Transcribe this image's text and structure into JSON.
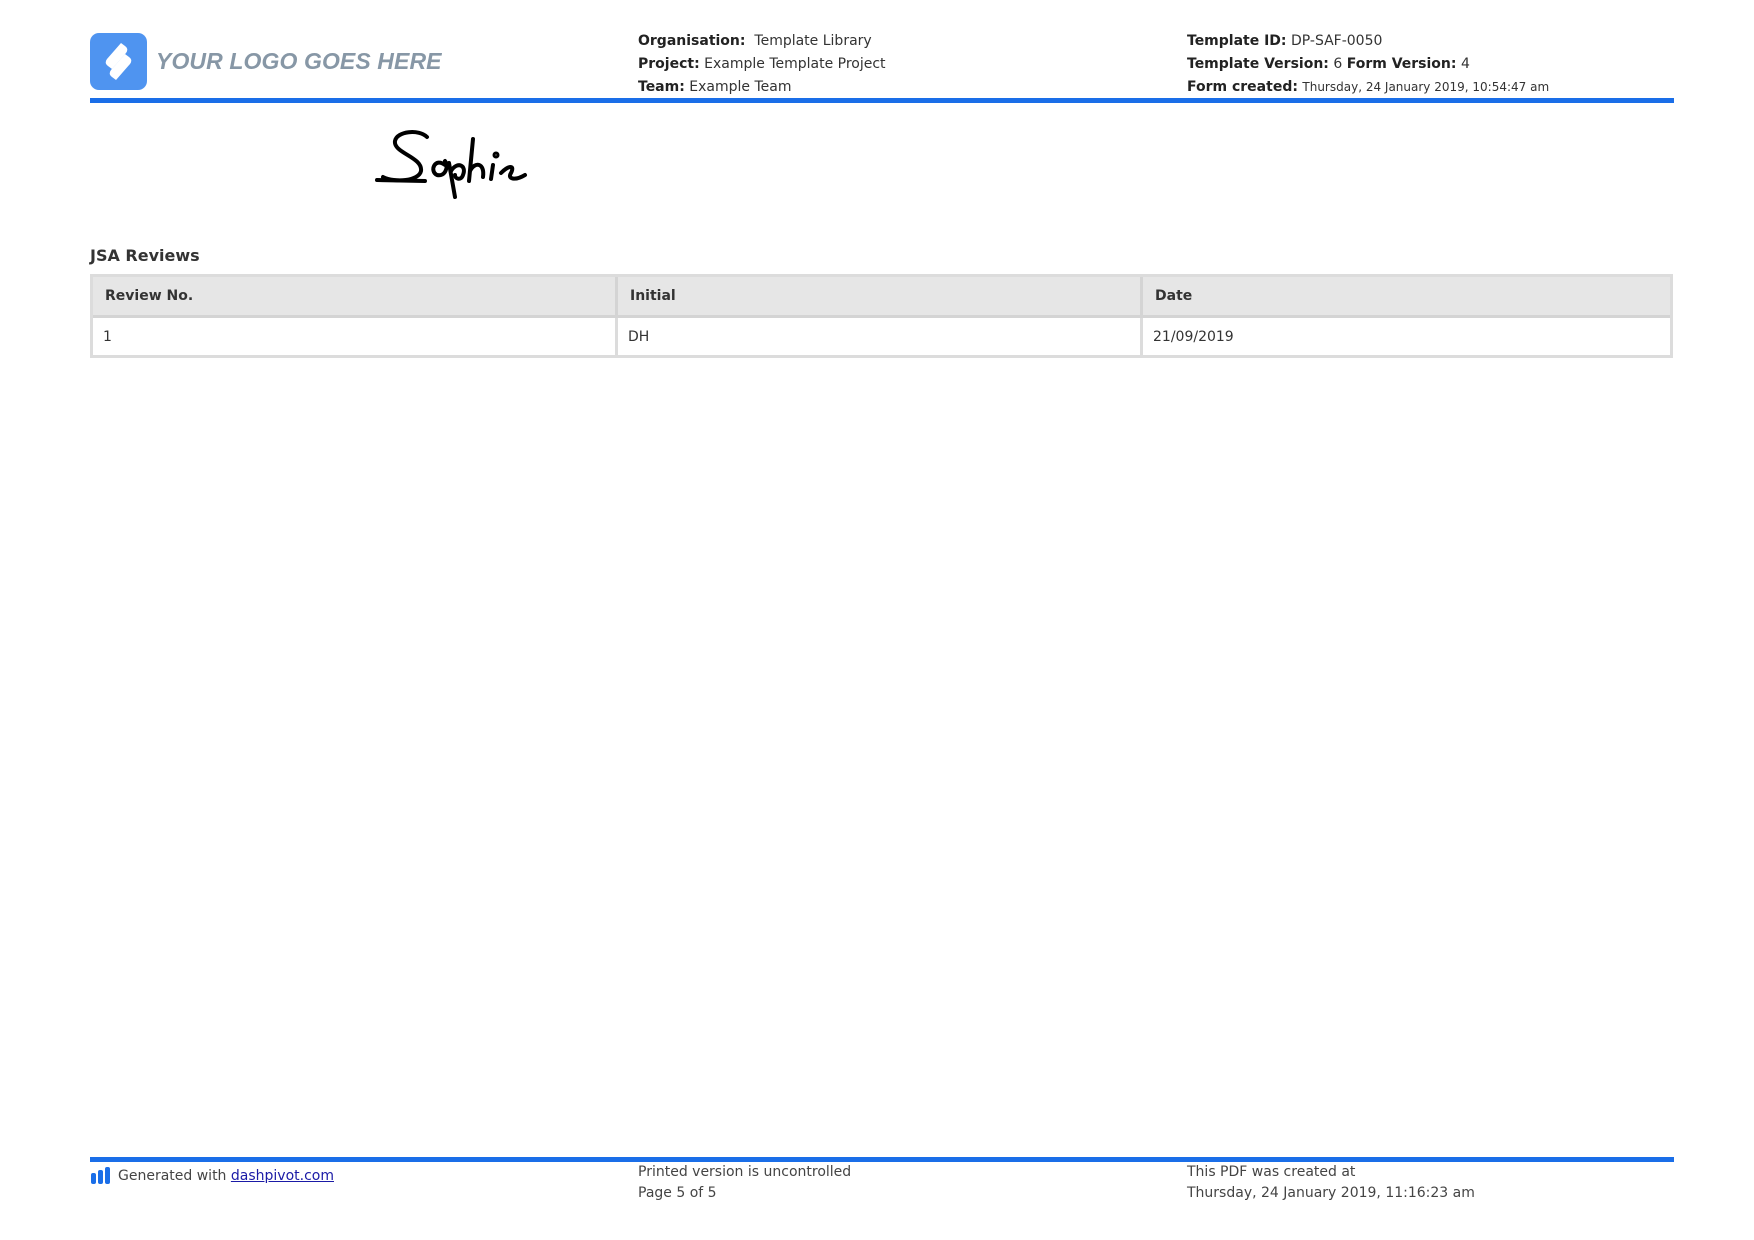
{
  "header": {
    "logo_text": "YOUR LOGO GOES HERE",
    "organisation_label": "Organisation:",
    "organisation_value": "Template Library",
    "project_label": "Project:",
    "project_value": "Example Template Project",
    "team_label": "Team:",
    "team_value": "Example Team",
    "template_id_label": "Template ID:",
    "template_id_value": "DP-SAF-0050",
    "template_version_label": "Template Version:",
    "template_version_value": "6",
    "form_version_label": "Form Version:",
    "form_version_value": "4",
    "form_created_label": "Form created:",
    "form_created_value": "Thursday, 24 January 2019, 10:54:47 am"
  },
  "signature": {
    "name": "Sophie"
  },
  "jsa_reviews": {
    "title": "JSA Reviews",
    "columns": [
      "Review No.",
      "Initial",
      "Date"
    ],
    "rows": [
      [
        "1",
        "DH",
        "21/09/2019"
      ]
    ]
  },
  "footer": {
    "generated_prefix": "Generated with",
    "generated_link": "dashpivot.com",
    "uncontrolled": "Printed version is uncontrolled",
    "page": "Page 5 of 5",
    "created_line1": "This PDF was created at",
    "created_line2": "Thursday, 24 January 2019, 11:16:23 am"
  },
  "colors": {
    "accent": "#1a6ee8",
    "logo_bg": "#4f94f0",
    "logo_text": "#8797a6",
    "table_header_bg": "#e6e6e6",
    "link": "#1a1aa6"
  },
  "icons": {
    "logo": "logo-icon",
    "footer": "dashpivot-bars-icon"
  }
}
